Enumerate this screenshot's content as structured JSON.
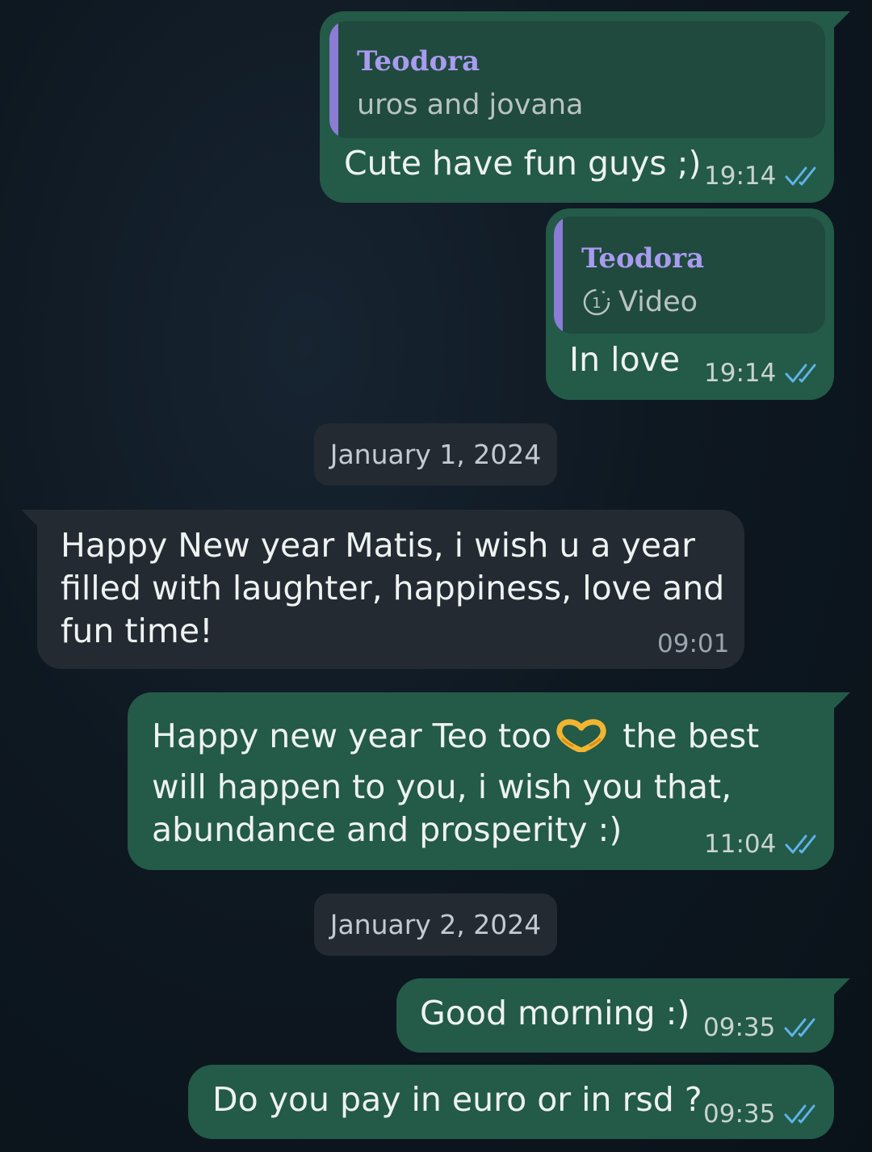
{
  "messages": [
    {
      "quote": {
        "author": "Teodora",
        "text": "uros and jovana"
      },
      "text": "Cute have fun guys ;)",
      "time": "19:14"
    },
    {
      "quote": {
        "author": "Teodora",
        "text": "Video",
        "icon": "view-once-icon"
      },
      "text": "In love",
      "time": "19:14"
    },
    {
      "date": "January 1, 2024"
    },
    {
      "lines": [
        "Happy New year Matis, i wish u a year",
        "filled with laughter, happiness, love and",
        "fun time!"
      ],
      "time": "09:01"
    },
    {
      "lines": [
        "Happy new year Teo too",
        "the best",
        "will happen to you, i wish you that,",
        "abundance and prosperity :)"
      ],
      "emoji": "heart-hands-emoji",
      "time": "11:04"
    },
    {
      "date": "January 2, 2024"
    },
    {
      "text": "Good morning :)",
      "time": "09:35"
    },
    {
      "text": "Do you pay in euro or in rsd ?",
      "time": "09:35"
    }
  ],
  "colors": {
    "outgoing": "#235a48",
    "incoming": "#232a32",
    "quote_bar": "#8b7cd6",
    "ticks": "#5fb3e8"
  }
}
